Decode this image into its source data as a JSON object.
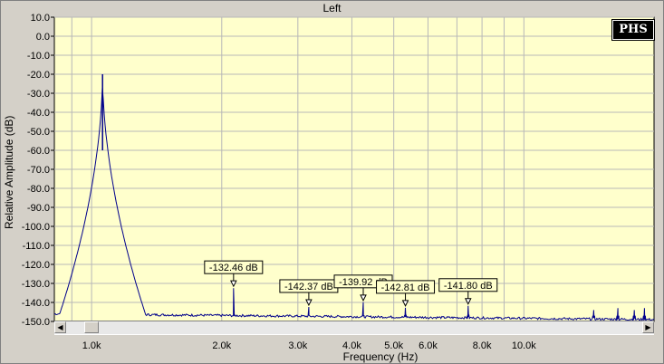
{
  "title": "Left",
  "logo_text": "PHS",
  "chart_data": {
    "type": "line",
    "xlabel": "Frequency (Hz)",
    "ylabel": "Relative Amplitude (dB)",
    "x_scale": "log",
    "xlim": [
      820,
      20000
    ],
    "ylim": [
      -150,
      10
    ],
    "y_ticks": [
      10,
      0,
      -10,
      -20,
      -30,
      -40,
      -50,
      -60,
      -70,
      -80,
      -90,
      -100,
      -110,
      -120,
      -130,
      -140,
      -150
    ],
    "y_tick_labels": [
      "10.0",
      "0.0",
      "-10.0",
      "-20.0",
      "-30.0",
      "-40.0",
      "-50.0",
      "-60.0",
      "-70.0",
      "-80.0",
      "-90.0",
      "-100.0",
      "-110.0",
      "-120.0",
      "-130.0",
      "-140.0",
      "-150.0"
    ],
    "x_ticks": [
      1000,
      2000,
      3000,
      4000,
      5000,
      6000,
      8000,
      10000
    ],
    "x_tick_labels": [
      "1.0k",
      "2.0k",
      "3.0k",
      "4.0k",
      "5.0k",
      "6.0k",
      "8.0k",
      "10.0k"
    ],
    "grid": true,
    "line_color": "#00008b",
    "background_color": "#ffffcc",
    "grid_color": "#b8b8b8",
    "peaks": [
      {
        "x": 1060,
        "y": -20
      },
      {
        "x": 2130,
        "y": -132.46
      },
      {
        "x": 3180,
        "y": -142.37
      },
      {
        "x": 4250,
        "y": -139.92
      },
      {
        "x": 5320,
        "y": -142.81
      },
      {
        "x": 7430,
        "y": -141.8
      }
    ],
    "annotations": [
      {
        "x": 2130,
        "y": -132.46,
        "text": "-132.46 dB"
      },
      {
        "x": 3180,
        "y": -142.37,
        "text": "-142.37 dB"
      },
      {
        "x": 4250,
        "y": -139.92,
        "text": "-139.92 dB"
      },
      {
        "x": 5320,
        "y": -142.81,
        "text": "-142.81 dB"
      },
      {
        "x": 7430,
        "y": -141.8,
        "text": "-141.80 dB"
      }
    ]
  }
}
